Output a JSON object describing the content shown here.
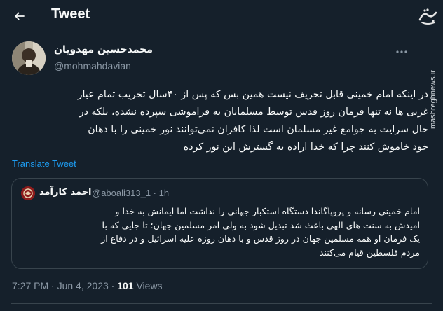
{
  "header": {
    "title": "Tweet",
    "watermark_logo_text": "مشرق",
    "watermark_text": "mashreghnews.ir"
  },
  "tweet": {
    "author_name": "محمدحسین مهدویان",
    "author_handle": "@mohmahdavian",
    "body_lines": [
      "در اینکه امام خمینی قابل تحریف نیست همین بس که پس از ۴۰سال تخریب تمام عیار",
      "غربی ها نه تنها فرمان روز قدس توسط مسلمانان به فراموشی سپرده نشده، بلکه در",
      "حال سرایت به جوامع غیر مسلمان است لذا کافران نمی‌توانند نور خمینی را با دهان",
      "خود خاموش کنند چرا که خدا اراده به گسترش این نور کرده"
    ],
    "translate_label": "Translate Tweet",
    "time": "7:27 PM",
    "separator": " · ",
    "date": "Jun 4, 2023",
    "views_count": "101",
    "views_label": " Views"
  },
  "quote": {
    "author_name": "احمد کارآمد",
    "author_handle": "@aboali313_1",
    "time": "· 1h",
    "body_lines": [
      "امام خمینی رسانه و پروپاگاندا دستگاه استکبار جهانی را نداشت اما ایمانش به خدا و",
      "امیدش به سنت های الهی باعث شد تبدیل شود به ولی امر مسلمین جهان؛ تا جایی که با",
      "یک فرمان او همه مسلمین جهان در روز قدس و با دهان روزه علیه اسرائیل و در دفاع از",
      "مردم فلسطین قیام می‌کنند"
    ]
  },
  "icons": {
    "back": "arrow-left-icon",
    "more": "more-dots-icon"
  },
  "colors": {
    "background": "#15202b",
    "text": "#f7f9f9",
    "muted": "#8b98a5",
    "link": "#1d9bf0",
    "border": "#38444d"
  }
}
